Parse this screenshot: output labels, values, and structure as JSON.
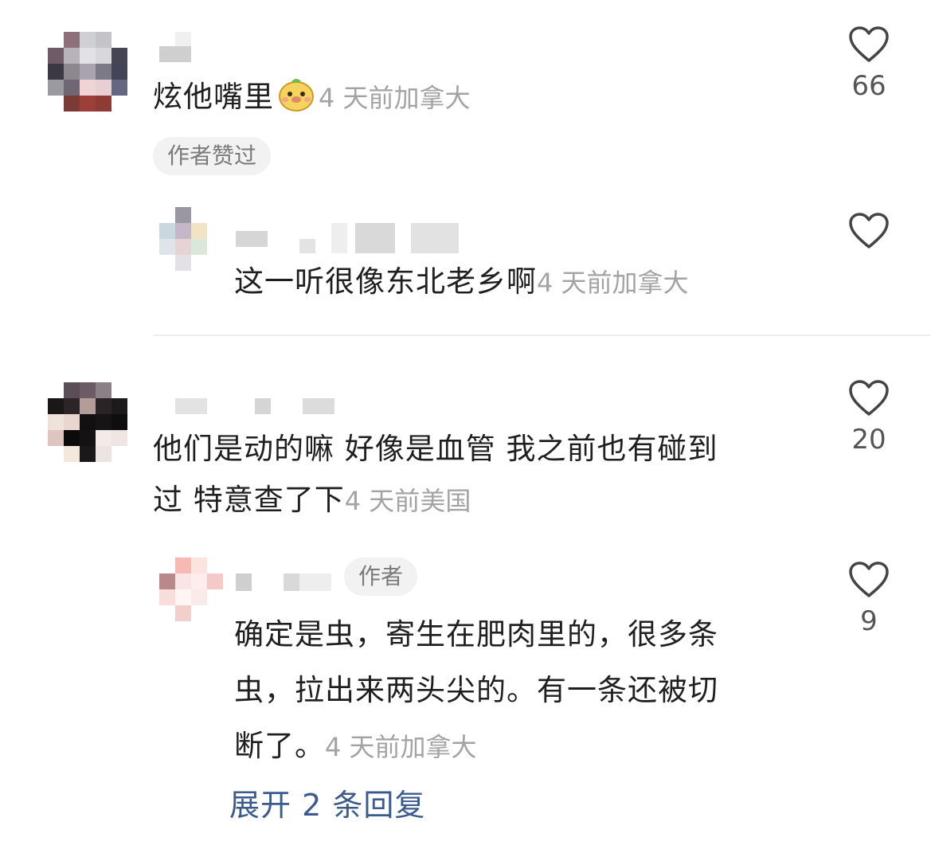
{
  "comments": [
    {
      "text": "炫他嘴里",
      "time": "4 天前",
      "location": "加拿大",
      "badge": "作者赞过",
      "likes": "66",
      "emoji": "yellow-dog-emoji-icon"
    },
    {
      "text": "这一听很像东北老乡啊",
      "time": "4 天前",
      "location": "加拿大"
    },
    {
      "text_line1": "他们是动的嘛 好像是血管 我之前也有碰到",
      "text_line2": "过 特意查了下",
      "time": "4 天前",
      "location": "美国",
      "likes": "20"
    },
    {
      "author_tag": "作者",
      "text_line1": "确定是虫，寄生在肥肉里的，很多条",
      "text_line2": "虫，拉出来两头尖的。有一条还被切",
      "text_line3": "断了。",
      "time": "4 天前",
      "location": "加拿大",
      "likes": "9"
    }
  ],
  "expand_replies": "展开 2 条回复",
  "colors": {
    "meta_gray": "#a3a3a3",
    "pill_bg": "#f2f2f2",
    "link_blue": "#3b5b8f"
  }
}
